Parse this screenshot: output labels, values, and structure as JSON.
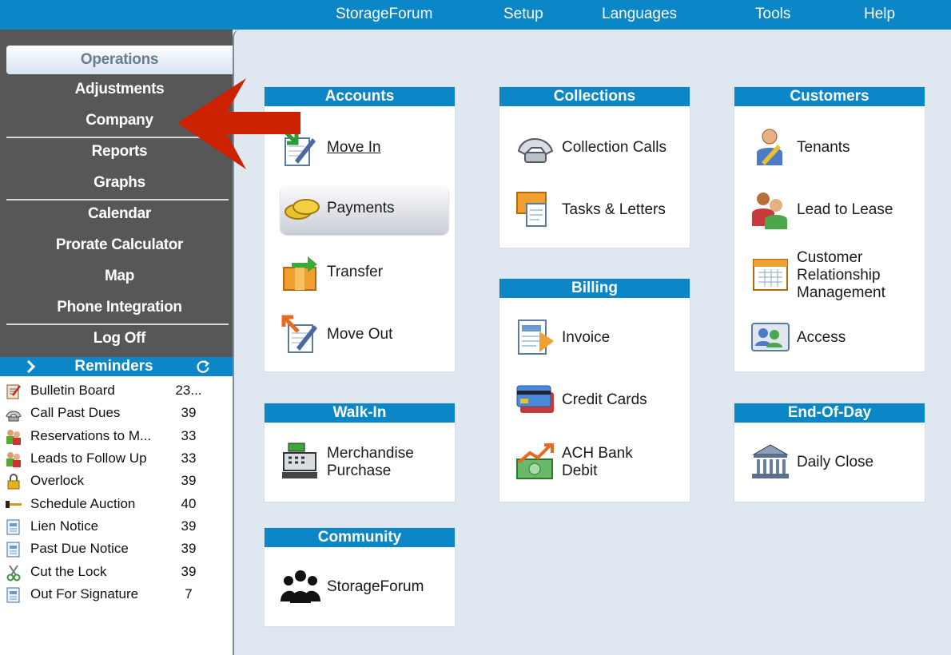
{
  "topmenu": [
    "StorageForum",
    "Setup",
    "Languages",
    "Tools",
    "Help"
  ],
  "nav": {
    "active": "Operations",
    "items": [
      "Adjustments",
      "Company",
      "Reports",
      "Graphs",
      "Calendar",
      "Prorate Calculator",
      "Map",
      "Phone Integration",
      "Log Off"
    ]
  },
  "reminders": {
    "title": "Reminders",
    "items": [
      {
        "label": "Bulletin Board",
        "count": "23..."
      },
      {
        "label": "Call Past Dues",
        "count": "39"
      },
      {
        "label": "Reservations to M...",
        "count": "33"
      },
      {
        "label": "Leads to Follow Up",
        "count": "33"
      },
      {
        "label": "Overlock",
        "count": "39"
      },
      {
        "label": "Schedule Auction",
        "count": "40"
      },
      {
        "label": "Lien Notice",
        "count": "39"
      },
      {
        "label": "Past Due Notice",
        "count": "39"
      },
      {
        "label": "Cut the Lock",
        "count": "39"
      },
      {
        "label": "Out For Signature",
        "count": "7"
      }
    ]
  },
  "panels": {
    "accounts": {
      "title": "Accounts",
      "items": [
        "Move In",
        "Payments",
        "Transfer",
        "Move Out"
      ]
    },
    "collections": {
      "title": "Collections",
      "items": [
        "Collection Calls",
        "Tasks & Letters"
      ]
    },
    "customers": {
      "title": "Customers",
      "items": [
        "Tenants",
        "Lead to Lease",
        "Customer Relationship Management",
        "Access"
      ]
    },
    "billing": {
      "title": "Billing",
      "items": [
        "Invoice",
        "Credit Cards",
        "ACH Bank Debit"
      ]
    },
    "walkin": {
      "title": "Walk-In",
      "items": [
        "Merchandise Purchase"
      ]
    },
    "endofday": {
      "title": "End-Of-Day",
      "items": [
        "Daily Close"
      ]
    },
    "community": {
      "title": "Community",
      "items": [
        "StorageForum"
      ]
    }
  },
  "colors": {
    "accent": "#0b86c6",
    "nav_bg": "#575757",
    "arrow": "#cc2200"
  }
}
